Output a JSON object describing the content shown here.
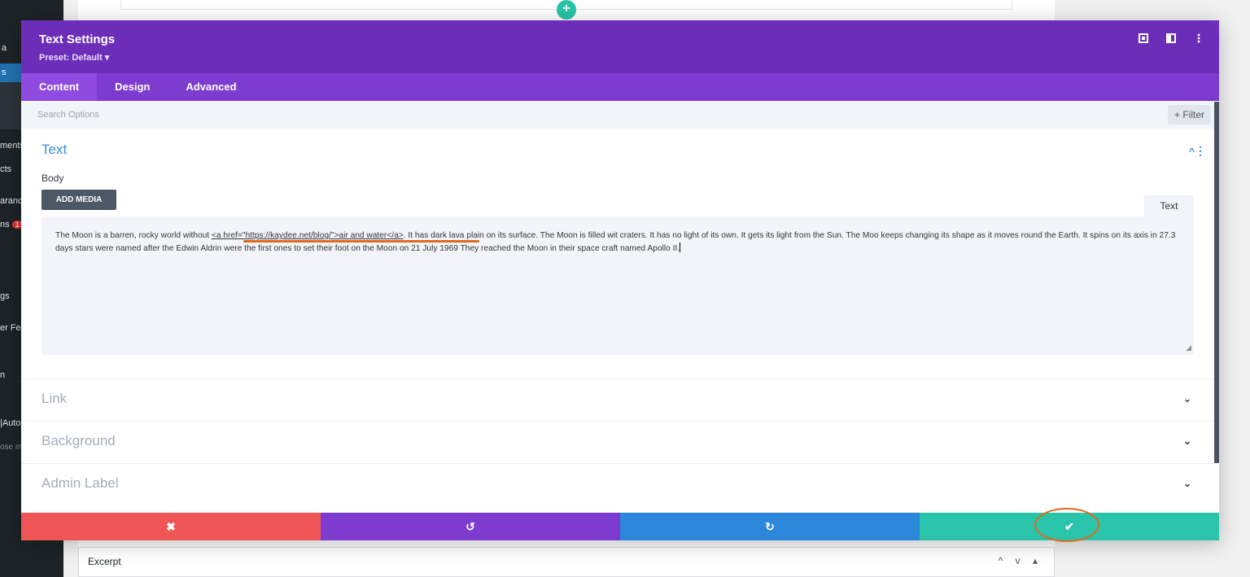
{
  "wp_sidebar": {
    "items": [
      {
        "label": "a"
      },
      {
        "label": "s"
      },
      {
        "label": "ments"
      },
      {
        "label": "cts"
      },
      {
        "label": "aranc"
      },
      {
        "label": "ns"
      },
      {
        "label": "gs"
      },
      {
        "label": "er Fee"
      },
      {
        "label": "n"
      },
      {
        "label": "|Auto"
      },
      {
        "label": "ose m"
      }
    ],
    "badge": "1"
  },
  "background": {
    "add_icon": "+",
    "excerpt_label": "Excerpt",
    "excerpt_controls": "^ v ▴"
  },
  "modal": {
    "title": "Text Settings",
    "preset": "Preset: Default ▾",
    "header_icons": [
      "maximize-icon",
      "split-view-icon",
      "more-icon"
    ],
    "tabs": [
      {
        "label": "Content",
        "active": true
      },
      {
        "label": "Design",
        "active": false
      },
      {
        "label": "Advanced",
        "active": false
      }
    ],
    "search_placeholder": "Search Options",
    "filter_label": "+ Filter",
    "text_section": {
      "title": "Text",
      "caret": "^",
      "dots": "⋮",
      "body_label": "Body",
      "add_media_label": "ADD MEDIA",
      "editor_mode_tab": "Text",
      "body_before": "The Moon is a barren, rocky world without ",
      "body_code": "<a href=\"https://kaydee.net/blog/\">air and water</a>",
      "body_after": ". It has dark lava plain on its surface. The Moon is filled wit craters. It has no light of its own. It gets its light from the Sun. The Moo keeps changing its shape as it moves round the Earth. It spins on its axis in 27.3 days stars were named after the Edwin Aldrin were the first ones to set their foot on the Moon on 21 July 1969 They reached the Moon in their space craft named Apollo II."
    },
    "collapsed_sections": [
      {
        "title": "Link"
      },
      {
        "title": "Background"
      },
      {
        "title": "Admin Label"
      }
    ],
    "footer": {
      "cancel_icon": "✖",
      "undo_icon": "↺",
      "redo_icon": "↻",
      "save_icon": "✔"
    },
    "colors": {
      "header": "#6c2eb9",
      "tabs": "#7e3bd0",
      "cancel": "#ef5555",
      "undo": "#7e3bd0",
      "redo": "#2b87da",
      "save": "#29c4a9",
      "section_title": "#3b8fd6",
      "annotation": "#e06b1f"
    }
  }
}
